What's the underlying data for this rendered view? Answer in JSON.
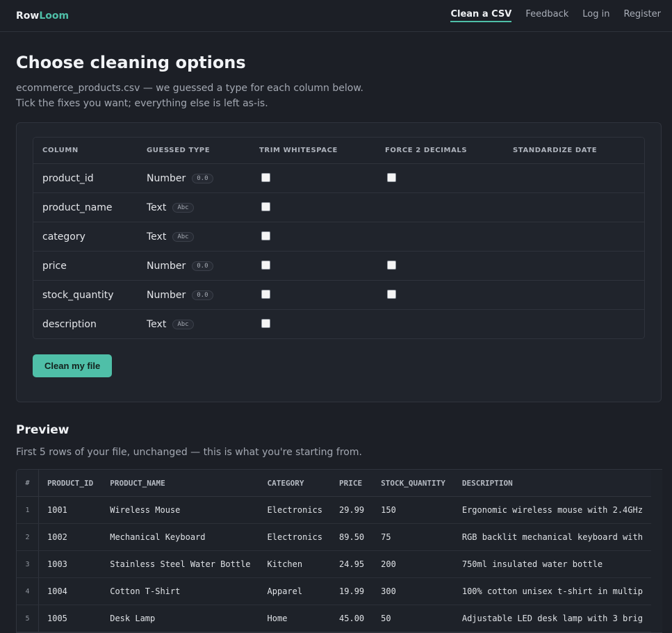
{
  "brand": {
    "part1": "Row",
    "part2": "Loom"
  },
  "nav": [
    "Clean a CSV",
    "Feedback",
    "Log in",
    "Register"
  ],
  "page": {
    "title": "Choose cleaning options",
    "subtitle": "ecommerce_products.csv — we guessed a type for each column below. Tick the fixes you want; everything else is left as-is."
  },
  "options": {
    "headers": [
      "COLUMN",
      "GUESSED TYPE",
      "TRIM WHITESPACE",
      "FORCE 2 DECIMALS",
      "STANDARDIZE DATE"
    ],
    "rows": [
      {
        "column": "product_id",
        "type": "Number",
        "badge": "0.0",
        "trim": true,
        "decimals": true
      },
      {
        "column": "product_name",
        "type": "Text",
        "badge": "Abc",
        "trim": true,
        "decimals": false
      },
      {
        "column": "category",
        "type": "Text",
        "badge": "Abc",
        "trim": true,
        "decimals": false
      },
      {
        "column": "price",
        "type": "Number",
        "badge": "0.0",
        "trim": true,
        "decimals": true
      },
      {
        "column": "stock_quantity",
        "type": "Number",
        "badge": "0.0",
        "trim": true,
        "decimals": true
      },
      {
        "column": "description",
        "type": "Text",
        "badge": "Abc",
        "trim": true,
        "decimals": false
      }
    ],
    "button": "Clean my file"
  },
  "preview": {
    "title": "Preview",
    "subtitle": "First 5 rows of your file, unchanged — this is what you're starting from.",
    "headers": [
      "#",
      "PRODUCT_ID",
      "PRODUCT_NAME",
      "CATEGORY",
      "PRICE",
      "STOCK_QUANTITY",
      "DESCRIPTION"
    ],
    "rows": [
      [
        "1",
        "1001",
        "Wireless Mouse",
        "Electronics",
        "29.99",
        "150",
        "Ergonomic wireless mouse with 2.4GHz"
      ],
      [
        "2",
        "1002",
        "Mechanical Keyboard",
        "Electronics",
        "89.50",
        "75",
        "RGB backlit mechanical keyboard with"
      ],
      [
        "3",
        "1003",
        "Stainless Steel Water Bottle",
        "Kitchen",
        "24.95",
        "200",
        "750ml insulated water bottle"
      ],
      [
        "4",
        "1004",
        "Cotton T-Shirt",
        "Apparel",
        "19.99",
        "300",
        "100% cotton unisex t-shirt in multip"
      ],
      [
        "5",
        "1005",
        "Desk Lamp",
        "Home",
        "45.00",
        "50",
        "Adjustable LED desk lamp with 3 brig"
      ]
    ]
  }
}
